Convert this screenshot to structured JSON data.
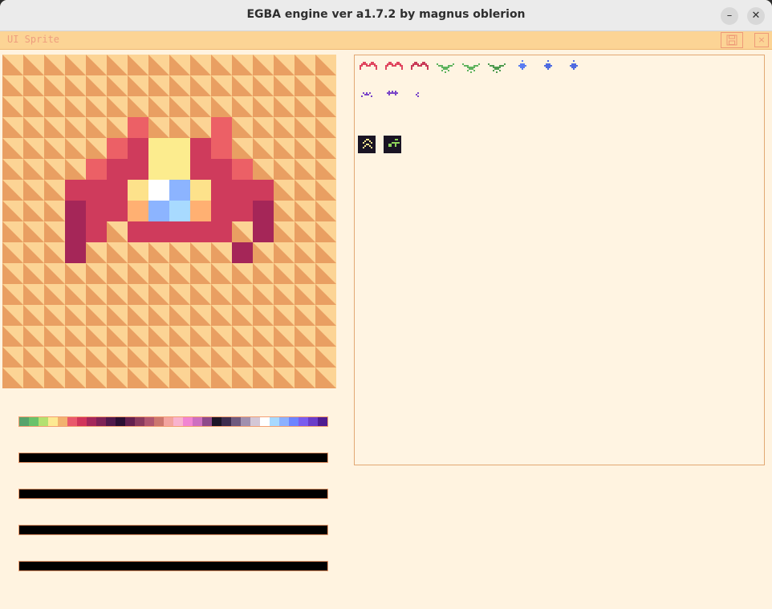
{
  "window": {
    "title": "EGBA engine ver a1.7.2 by magnus oblerion",
    "minimize_glyph": "–",
    "close_glyph": "✕"
  },
  "menubar": {
    "title": "UI Sprite",
    "save_icon": "floppy-disk-icon",
    "close_glyph": "×"
  },
  "colors": {
    "checker_light": "#fcd495",
    "checker_dark": "#e99f62",
    "bar_border": "#f39f72",
    "panel_border": "#e2a873"
  },
  "palette_rows": [
    [
      "#57a36c",
      "#6ac26a",
      "#b4e070",
      "#fde992",
      "#f2b16f",
      "#e9586c",
      "#d1345b",
      "#a4275b",
      "#7e2257",
      "#50194c",
      "#2b0f33",
      "#64204f",
      "#8a3a5e",
      "#b0566f",
      "#cc776e",
      "#f3a49f",
      "#f9b3ce",
      "#f185d2",
      "#cd6fc0",
      "#8e4a8a",
      "#1c1527",
      "#3d2d4f",
      "#6f5a7f",
      "#a08fae",
      "#d4c7d6",
      "#ffffff",
      "#a8d9ff",
      "#8cb0ff",
      "#6d84ff",
      "#7a5cee",
      "#6a3cc9",
      "#4e1c92"
    ],
    [],
    [],
    [],
    []
  ],
  "canvas_sprite": {
    "grid": 16,
    "pixels": [
      "................",
      "................",
      "................",
      "......A...A.....",
      ".....AByyBA.....",
      "....ABByyBBA....",
      "...BBBYwbYBBB...",
      "...DBBObcOBBD...",
      "...DB.BBBBB.D...",
      "...D.......D....",
      "................",
      "................",
      "................",
      "................",
      "................",
      "................"
    ],
    "legend": {
      "A": "#ec6066",
      "B": "#cf3b5c",
      "D": "#a52658",
      "y": "#fcec8e",
      "Y": "#fde28b",
      "w": "#ffffff",
      "b": "#8cb4ff",
      "c": "#a8daff",
      "O": "#ffb072"
    }
  },
  "sprite_sheet": [
    {
      "name": "red-ship-1",
      "col": 0,
      "row": 0,
      "kind": "ship",
      "color": "#e0465f"
    },
    {
      "name": "red-ship-2",
      "col": 1,
      "row": 0,
      "kind": "ship",
      "color": "#e0465f"
    },
    {
      "name": "red-ship-3",
      "col": 2,
      "row": 0,
      "kind": "ship",
      "color": "#c93a57"
    },
    {
      "name": "green-bug-1",
      "col": 3,
      "row": 0,
      "kind": "bug",
      "color": "#5fb35e"
    },
    {
      "name": "green-bug-2",
      "col": 4,
      "row": 0,
      "kind": "bug",
      "color": "#5fb35e"
    },
    {
      "name": "green-bug-3",
      "col": 5,
      "row": 0,
      "kind": "bug",
      "color": "#4e9a4f"
    },
    {
      "name": "blue-drop-1",
      "col": 6,
      "row": 0,
      "kind": "drop",
      "color": "#5a7cf0"
    },
    {
      "name": "blue-drop-2",
      "col": 7,
      "row": 0,
      "kind": "drop",
      "color": "#4f6be0"
    },
    {
      "name": "blue-drop-3",
      "col": 8,
      "row": 0,
      "kind": "drop",
      "color": "#4f6be0"
    },
    {
      "name": "purple-bit-1",
      "col": 0,
      "row": 1,
      "kind": "small",
      "color": "#7a44c8"
    },
    {
      "name": "purple-bit-2",
      "col": 1,
      "row": 1,
      "kind": "small2",
      "color": "#7a44c8"
    },
    {
      "name": "purple-bit-3",
      "col": 2,
      "row": 1,
      "kind": "tiny",
      "color": "#7a44c8"
    },
    {
      "name": "yellow-chevron-icon",
      "col": 0,
      "row": 2,
      "kind": "chevron",
      "color": "#fde992"
    },
    {
      "name": "green-plus-icon",
      "col": 1,
      "row": 2,
      "kind": "plus",
      "color": "#8ed35a"
    }
  ]
}
